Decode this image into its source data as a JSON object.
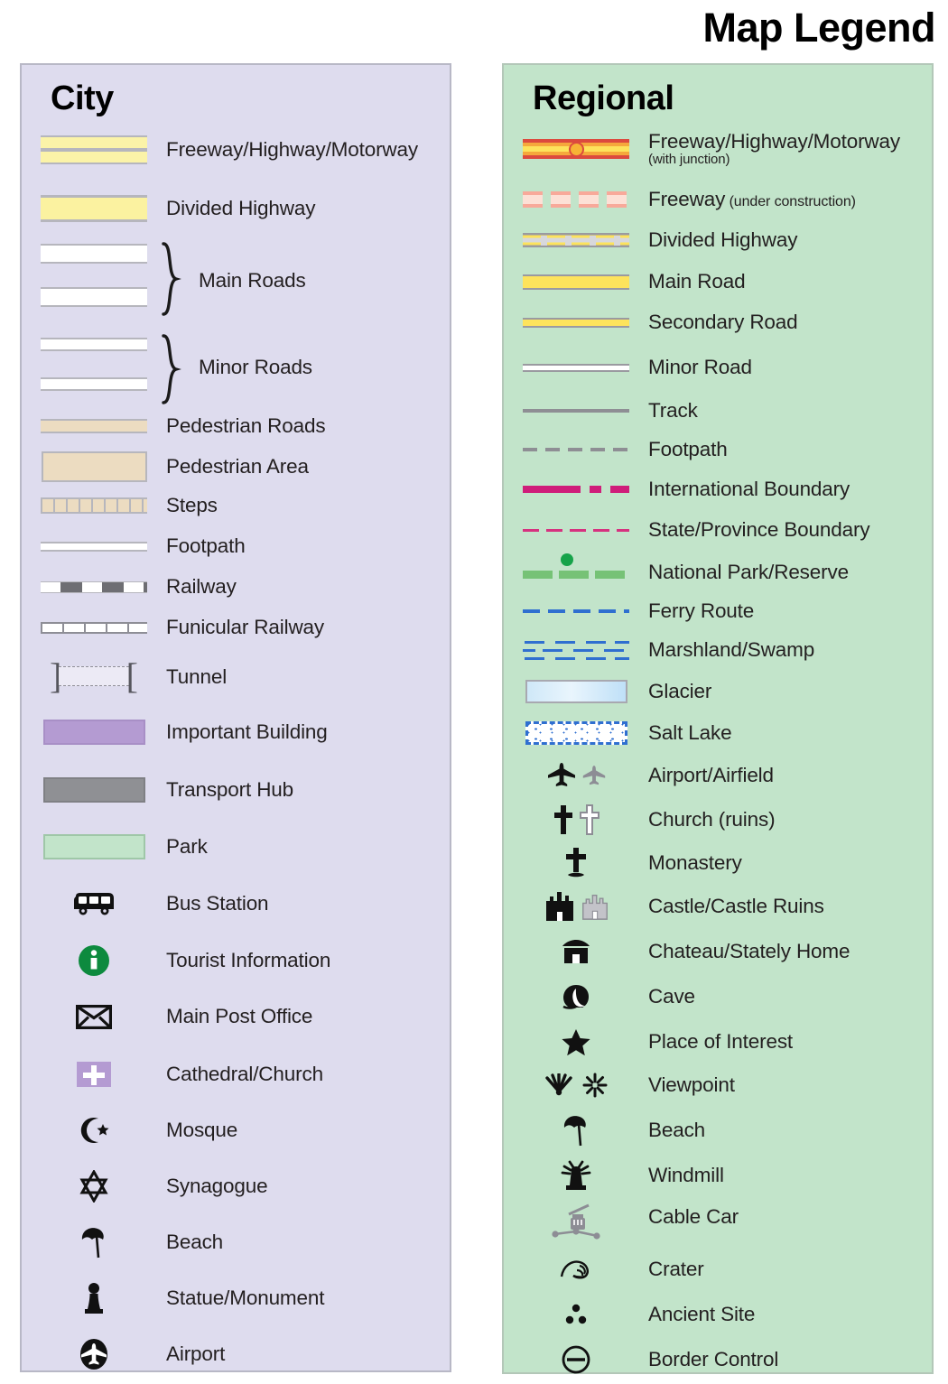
{
  "page": {
    "title": "Map Legend"
  },
  "city": {
    "heading": "City",
    "items": [
      {
        "label": "Freeway/Highway/Motorway",
        "symbol": "freeway-double-band"
      },
      {
        "label": "Divided Highway",
        "symbol": "divided-highway-band"
      },
      {
        "label": "Main Roads",
        "symbol": "white-road-pair-braced"
      },
      {
        "label": "Minor Roads",
        "symbol": "white-thin-road-pair-braced"
      },
      {
        "label": "Pedestrian Roads",
        "symbol": "pedestrian-road-band"
      },
      {
        "label": "Pedestrian Area",
        "symbol": "pedestrian-area-box"
      },
      {
        "label": "Steps",
        "symbol": "steps-band"
      },
      {
        "label": "Footpath",
        "symbol": "footpath-thin-line"
      },
      {
        "label": "Railway",
        "symbol": "railway-dashed-line"
      },
      {
        "label": "Funicular Railway",
        "symbol": "funicular-ticked-line"
      },
      {
        "label": "Tunnel",
        "symbol": "tunnel-bracket"
      },
      {
        "label": "Important Building",
        "symbol": "purple-swatch"
      },
      {
        "label": "Transport Hub",
        "symbol": "grey-swatch"
      },
      {
        "label": "Park",
        "symbol": "green-swatch"
      },
      {
        "label": "Bus Station",
        "symbol": "bus-icon"
      },
      {
        "label": "Tourist Information",
        "symbol": "info-circle-icon"
      },
      {
        "label": "Main Post Office",
        "symbol": "envelope-icon"
      },
      {
        "label": "Cathedral/Church",
        "symbol": "cross-on-purple-icon"
      },
      {
        "label": "Mosque",
        "symbol": "crescent-star-icon"
      },
      {
        "label": "Synagogue",
        "symbol": "star-of-david-icon"
      },
      {
        "label": "Beach",
        "symbol": "parasol-icon"
      },
      {
        "label": "Statue/Monument",
        "symbol": "statue-icon"
      },
      {
        "label": "Airport",
        "symbol": "airplane-circle-icon"
      }
    ]
  },
  "regional": {
    "heading": "Regional",
    "items": [
      {
        "label": "Freeway/Highway/Motorway",
        "sub": "(with junction)",
        "symbol": "freeway-junction-line"
      },
      {
        "label": "Freeway",
        "small": " (under construction)",
        "symbol": "freeway-construction-dashes"
      },
      {
        "label": "Divided Highway",
        "symbol": "divided-highway-line"
      },
      {
        "label": "Main Road",
        "symbol": "main-road-line"
      },
      {
        "label": "Secondary Road",
        "symbol": "secondary-road-line"
      },
      {
        "label": "Minor Road",
        "symbol": "minor-road-line"
      },
      {
        "label": "Track",
        "symbol": "track-line"
      },
      {
        "label": "Footpath",
        "symbol": "footpath-dashed-line"
      },
      {
        "label": "International Boundary",
        "symbol": "international-boundary-line"
      },
      {
        "label": "State/Province Boundary",
        "symbol": "state-boundary-line"
      },
      {
        "label": "National Park/Reserve",
        "symbol": "national-park-line"
      },
      {
        "label": "Ferry Route",
        "symbol": "ferry-route-line"
      },
      {
        "label": "Marshland/Swamp",
        "symbol": "marshland-pattern"
      },
      {
        "label": "Glacier",
        "symbol": "glacier-swatch"
      },
      {
        "label": "Salt Lake",
        "symbol": "salt-lake-swatch"
      },
      {
        "label": "Airport/Airfield",
        "symbol": "airplane-pair-icon"
      },
      {
        "label": "Church (ruins)",
        "symbol": "cross-pair-icon"
      },
      {
        "label": "Monastery",
        "symbol": "patriarchal-cross-icon"
      },
      {
        "label": "Castle/Castle Ruins",
        "symbol": "castle-pair-icon"
      },
      {
        "label": "Chateau/Stately Home",
        "symbol": "chateau-icon"
      },
      {
        "label": "Cave",
        "symbol": "cave-icon"
      },
      {
        "label": "Place of Interest",
        "symbol": "star-icon"
      },
      {
        "label": "Viewpoint",
        "symbol": "viewpoint-pair-icon"
      },
      {
        "label": "Beach",
        "symbol": "parasol-icon"
      },
      {
        "label": "Windmill",
        "symbol": "windmill-icon"
      },
      {
        "label": "Cable Car",
        "symbol": "cable-car-icon"
      },
      {
        "label": "Crater",
        "symbol": "crater-icon"
      },
      {
        "label": "Ancient Site",
        "symbol": "ancient-site-dots-icon"
      },
      {
        "label": "Border Control",
        "symbol": "border-control-icon"
      }
    ]
  },
  "colors": {
    "city_panel_bg": "#dedcee",
    "regional_panel_bg": "#c2e4ca",
    "highway_yellow": "#fbf3a8",
    "pedestrian_tan": "#ecdcc1",
    "important_building_purple": "#b49bd2",
    "transport_hub_grey": "#8f9094",
    "park_green": "#c2e4ca",
    "freeway_red": "#dc4a3e",
    "freeway_yellow": "#fde35c",
    "boundary_magenta": "#cf1d7a",
    "ferry_blue": "#2f6fd0",
    "park_line_green": "#76c276",
    "tourist_info_green": "#0d8a3e"
  }
}
